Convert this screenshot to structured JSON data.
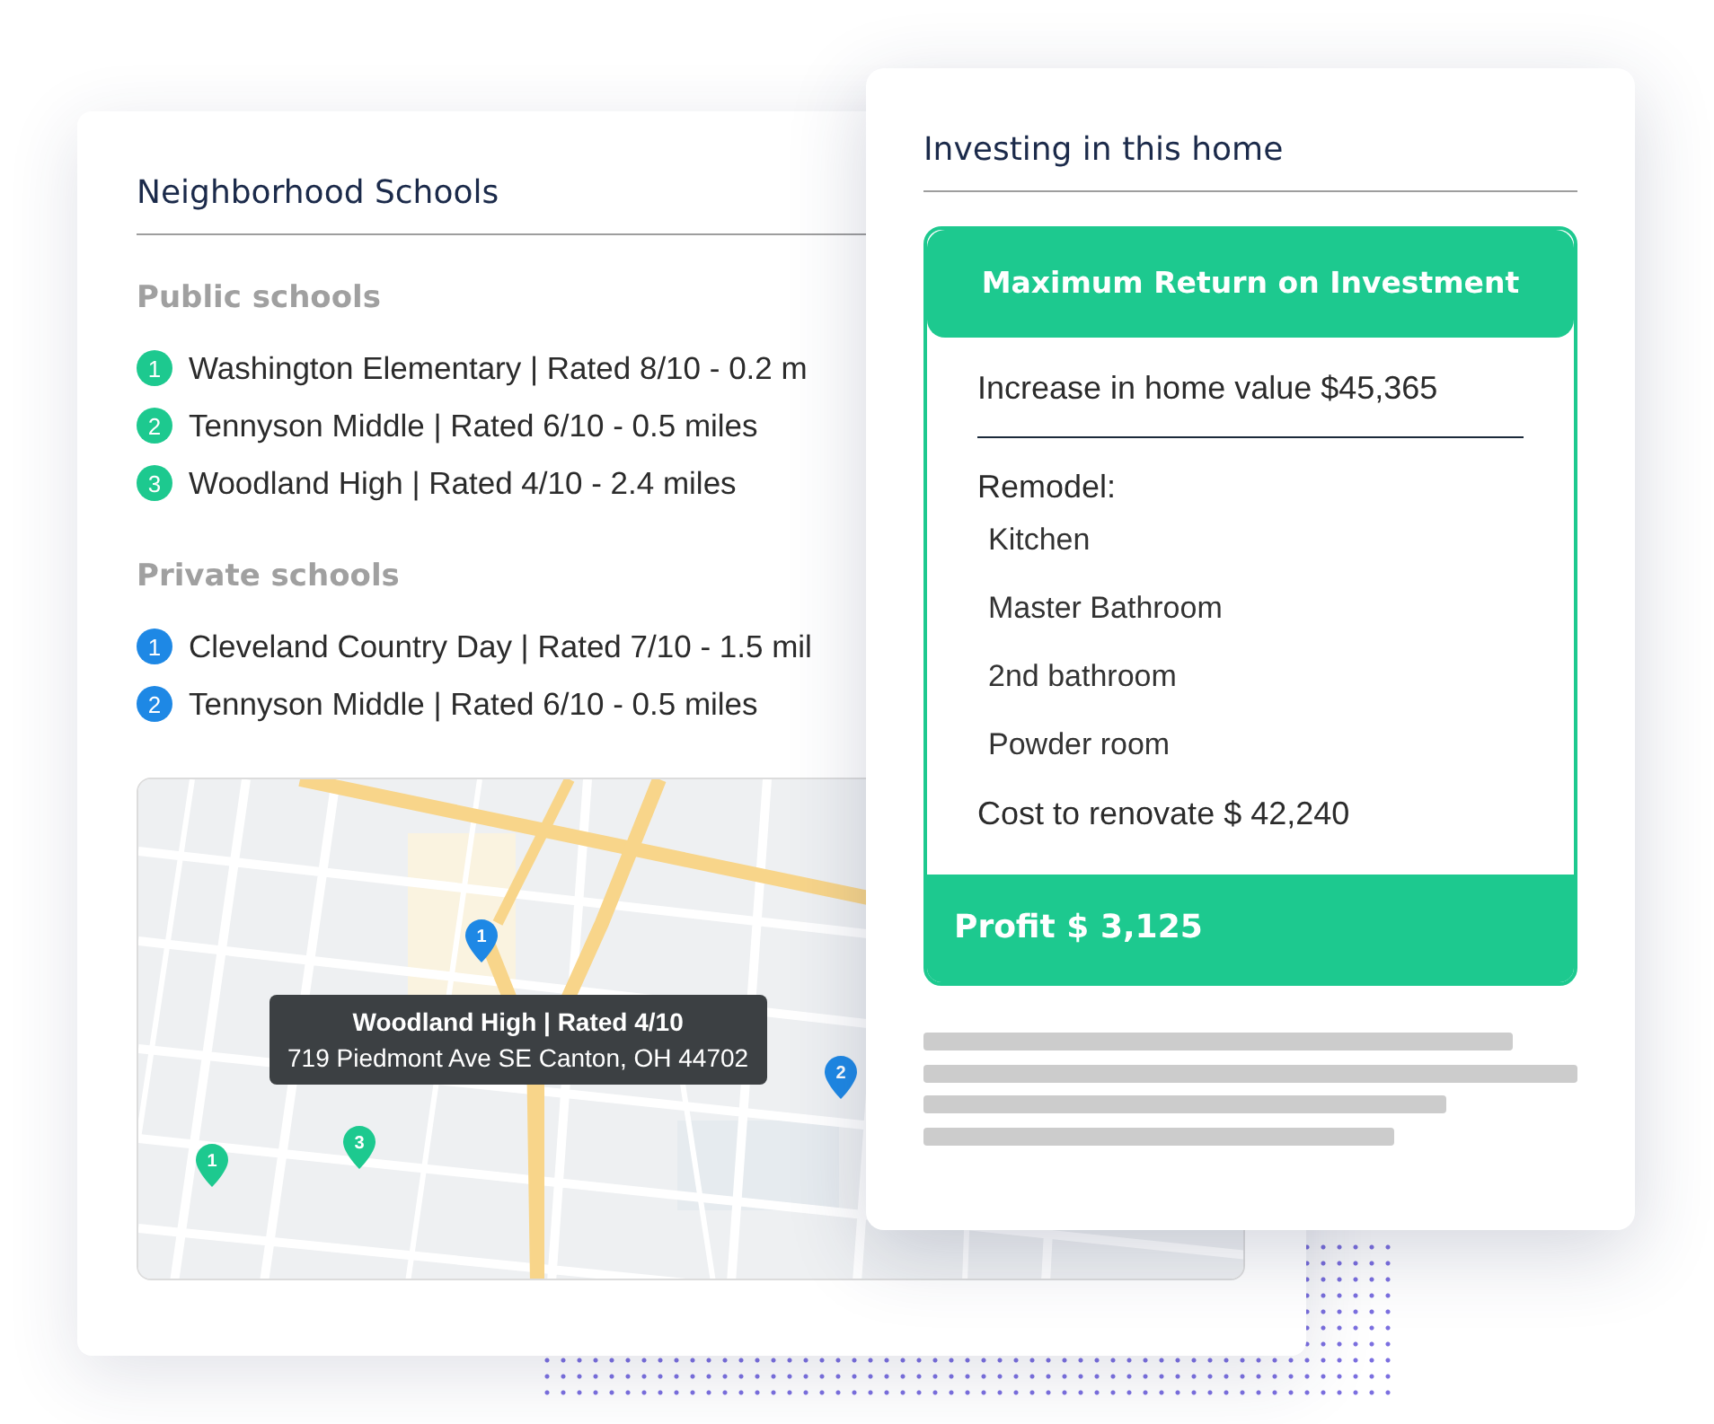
{
  "schools_card": {
    "title": "Neighborhood Schools",
    "sections": [
      {
        "heading": "Public schools",
        "color": "#1dc98f",
        "schools": [
          {
            "number": "1",
            "text": "Washington Elementary | Rated 8/10 - 0.2 m"
          },
          {
            "number": "2",
            "text": "Tennyson Middle | Rated 6/10 - 0.5 miles"
          },
          {
            "number": "3",
            "text": "Woodland High | Rated 4/10 - 2.4 miles"
          }
        ]
      },
      {
        "heading": "Private schools",
        "color": "#1e88e5",
        "schools": [
          {
            "number": "1",
            "text": "Cleveland Country Day | Rated 7/10 - 1.5 mil"
          },
          {
            "number": "2",
            "text": "Tennyson Middle | Rated 6/10 - 0.5 miles"
          }
        ]
      }
    ],
    "map": {
      "kind": "picture",
      "pins": [
        {
          "number": "1",
          "color": "#1e88e5"
        },
        {
          "number": "2",
          "color": "#1e88e5"
        },
        {
          "number": "3",
          "color": "#1dc98f"
        },
        {
          "number": "1",
          "color": "#1dc98f"
        }
      ],
      "tooltip": {
        "title": "Woodland High | Rated 4/10",
        "address": "719 Piedmont Ave SE Canton, OH 44702"
      }
    }
  },
  "investment_card": {
    "title": "Investing in this home",
    "box": {
      "header": "Maximum Return on Investment",
      "increase": "Increase in home value $45,365",
      "remodel_label": "Remodel:",
      "remodel_items": [
        "Kitchen",
        "Master Bathroom",
        "2nd bathroom",
        "Powder room"
      ],
      "cost": "Cost to renovate $ 42,240",
      "profit": "Profit $ 3,125"
    }
  }
}
